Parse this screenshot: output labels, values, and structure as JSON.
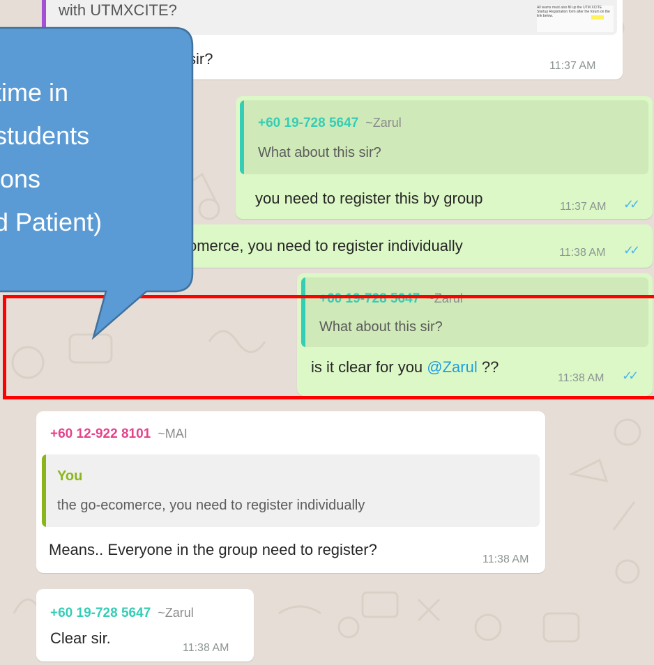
{
  "top_message": {
    "quote_text": "with UTMXCITE?",
    "thumbnail_caption": "All teams must also fill up the UTM XCITE Startup Registration form after the forum on the link below.",
    "body": "sir?",
    "time": "11:37 AM"
  },
  "reply1": {
    "quote_sender": "+60 19-728 5647",
    "quote_name": "~Zarul",
    "quote_text": "What about this sir?",
    "body": "you need to register this by group",
    "time": "11:37 AM"
  },
  "reply2": {
    "body": "omerce, you need to register individually",
    "time": "11:38 AM"
  },
  "reply3": {
    "quote_sender": "+60 19-728 5647",
    "quote_name": "~Zarul",
    "quote_text": "What about this sir?",
    "body_prefix": "is it clear for you ",
    "mention": "@Zarul",
    "body_suffix": " ??",
    "time": "11:38 AM"
  },
  "incoming_mai": {
    "sender": "+60 12-922 8101",
    "name": "~MAI",
    "quote_sender": "You",
    "quote_text": "the go-ecomerce, you need to register individually",
    "body": "Means.. Everyone in the group need to register?",
    "time": "11:38 AM"
  },
  "incoming_zarul": {
    "sender": "+60 19-728 5647",
    "name": "~Zarul",
    "body": "Clear sir.",
    "time": "11:38 AM"
  },
  "callout": {
    "lines": [
      "time in",
      "students",
      "ions",
      "d Patient)"
    ]
  },
  "colors": {
    "outgoing_bubble": "#dcf8c6",
    "incoming_bubble": "#ffffff",
    "teal_accent": "#35cdb5",
    "mai_accent": "#e5428a",
    "you_accent": "#8ab61c",
    "callout_fill": "#5b9bd5",
    "highlight_box": "#ff0000",
    "read_ticks": "#4fb6ec"
  }
}
